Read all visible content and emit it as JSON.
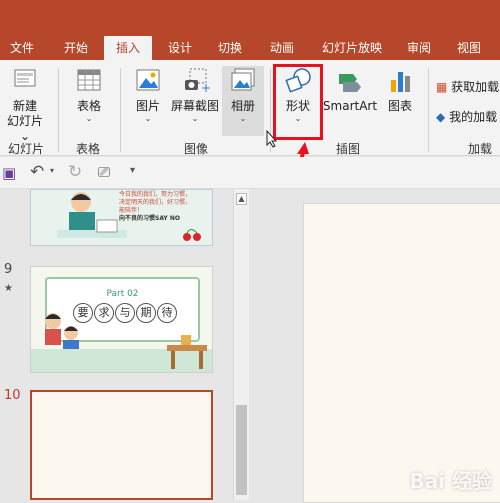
{
  "tabs": [
    "文件",
    "开始",
    "插入",
    "设计",
    "切换",
    "动画",
    "幻灯片放映",
    "审阅",
    "视图"
  ],
  "active_tab": "插入",
  "ribbon": {
    "new_slide": {
      "line1": "新建",
      "line2": "幻灯片"
    },
    "table": "表格",
    "picture": "图片",
    "screenshot": "屏幕截图",
    "album": "相册",
    "shapes": "形状",
    "smartart": "SmartArt",
    "chart": "图表",
    "get_addins": "获取加载",
    "my_addins": "我的加载",
    "groups": {
      "slides": "幻灯片",
      "tables": "表格",
      "images": "图像",
      "illustrations": "插图",
      "addins": "加载项"
    }
  },
  "slides": {
    "num_9": "9",
    "num_10": "10",
    "slide8_text1": "今日我的我们，努力习惯，",
    "slide8_text2": "决定明天的我们，好习惯，",
    "slide8_text3": "能陪伴！",
    "slide8_text4": "向不良的习惯SAY NO",
    "slide9_part": "Part 02",
    "slide9_title_chars": [
      "要",
      "求",
      "与",
      "期",
      "待"
    ]
  },
  "watermark": "Bai 经验",
  "colors": {
    "accent": "#b7472a",
    "highlight": "#e8121e"
  }
}
